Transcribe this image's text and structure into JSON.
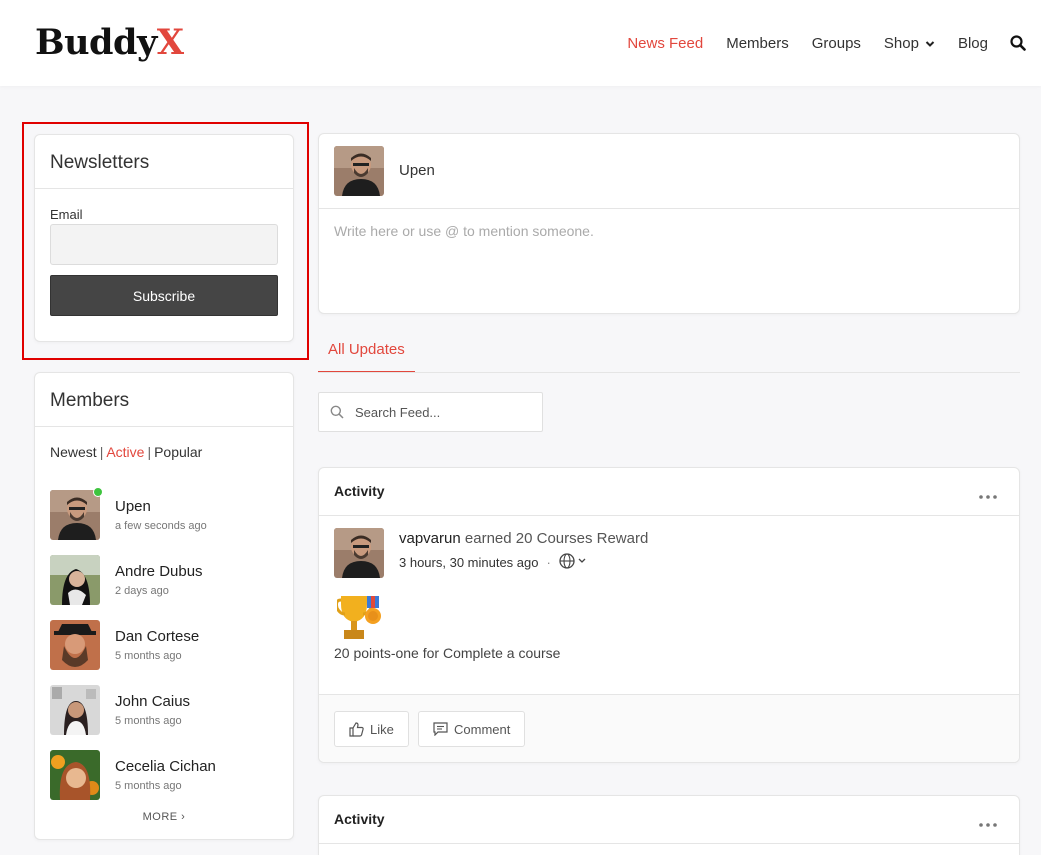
{
  "header": {
    "logo_main": "Buddy",
    "logo_accent": "X",
    "nav": [
      {
        "label": "News Feed",
        "active": true
      },
      {
        "label": "Members",
        "active": false
      },
      {
        "label": "Groups",
        "active": false
      },
      {
        "label": "Shop",
        "active": false,
        "dropdown": true
      },
      {
        "label": "Blog",
        "active": false
      }
    ],
    "search_icon": "search-icon"
  },
  "newsletter": {
    "title": "Newsletters",
    "email_label": "Email",
    "email_value": "",
    "subscribe_label": "Subscribe"
  },
  "members_widget": {
    "title": "Members",
    "filters": {
      "newest": "Newest",
      "active": "Active",
      "popular": "Popular",
      "separator": "|"
    },
    "list": [
      {
        "name": "Upen",
        "time": "a few seconds ago",
        "online": true
      },
      {
        "name": "Andre Dubus",
        "time": "2 days ago",
        "online": false
      },
      {
        "name": "Dan Cortese",
        "time": "5 months ago",
        "online": false
      },
      {
        "name": "John Caius",
        "time": "5 months ago",
        "online": false
      },
      {
        "name": "Cecelia Cichan",
        "time": "5 months ago",
        "online": false
      }
    ],
    "more_label": "MORE ›"
  },
  "postbox": {
    "user_name": "Upen",
    "placeholder": "Write here or use @ to mention someone."
  },
  "tabs": [
    {
      "label": "All Updates",
      "active": true
    }
  ],
  "feed_search": {
    "placeholder": "Search Feed..."
  },
  "activities": [
    {
      "title": "Activity",
      "user": "vapvarun",
      "action": " earned 20 Courses Reward",
      "time": "3 hours, 30 minutes ago",
      "separator": "·",
      "text": "20 points-one for Complete a course",
      "like_label": "Like",
      "comment_label": "Comment"
    },
    {
      "title": "Activity"
    }
  ],
  "colors": {
    "accent": "#e2473d",
    "button_dark": "#454545",
    "online": "#3ec43e",
    "highlight": "#e00000"
  }
}
